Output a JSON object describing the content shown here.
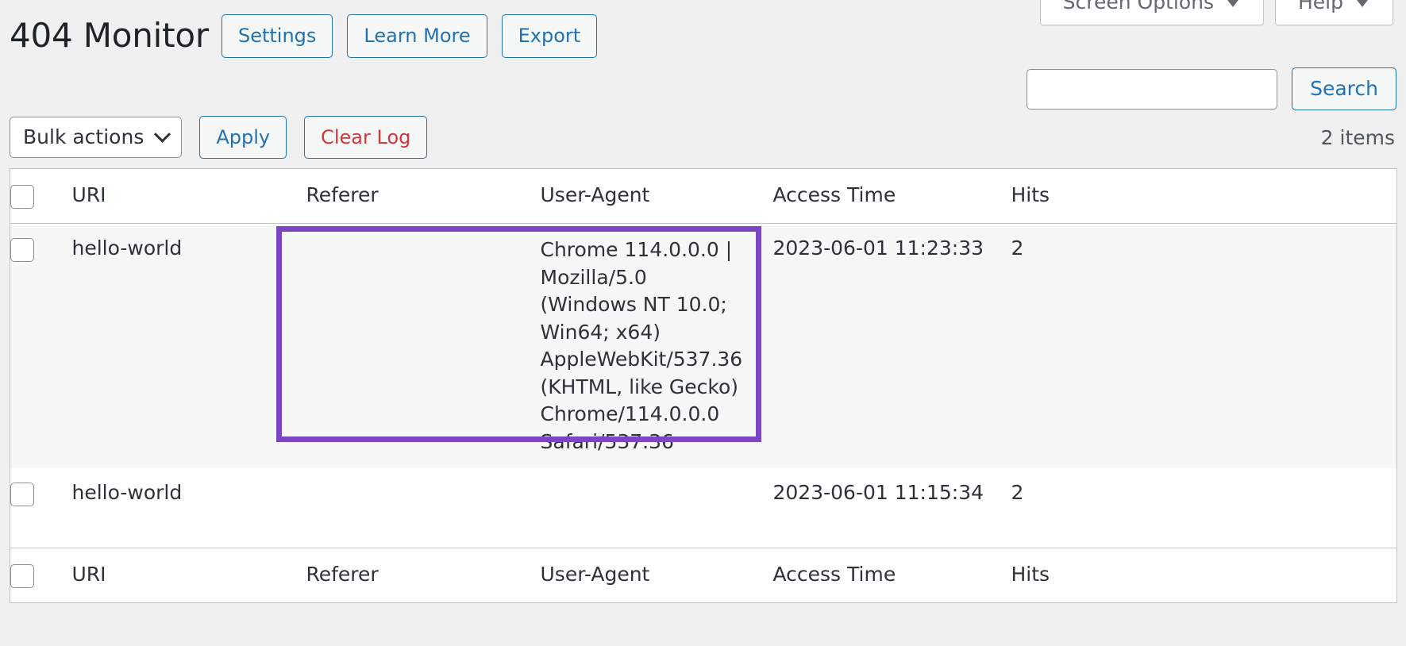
{
  "screen_meta": {
    "screen_options_label": "Screen Options",
    "help_label": "Help",
    "caret_icon": "caret-down-icon"
  },
  "header": {
    "page_title": "404 Monitor",
    "buttons": [
      {
        "label": "Settings",
        "style": "link-blue"
      },
      {
        "label": "Learn More",
        "style": "link-blue"
      },
      {
        "label": "Export",
        "style": "link-blue"
      }
    ]
  },
  "search": {
    "value": "",
    "placeholder": "",
    "button_label": "Search"
  },
  "tablenav": {
    "bulk_actions_label": "Bulk actions",
    "bulk_actions_icon": "chevron-down-icon",
    "apply_label": "Apply",
    "clear_log_label": "Clear Log",
    "items_count": "2 items"
  },
  "table": {
    "columns": [
      {
        "key": "cb",
        "label": "",
        "sortable": false
      },
      {
        "key": "uri",
        "label": "URI",
        "sortable": true
      },
      {
        "key": "ref",
        "label": "Referer",
        "sortable": false
      },
      {
        "key": "ua",
        "label": "User-Agent",
        "sortable": false
      },
      {
        "key": "time",
        "label": "Access Time",
        "sortable": true
      },
      {
        "key": "hits",
        "label": "Hits",
        "sortable": false
      }
    ],
    "rows": [
      {
        "uri": "hello-world",
        "referer": "",
        "user_agent": "Chrome 114.0.0.0 | Mozilla/5.0 (Windows NT 10.0; Win64; x64) AppleWebKit/537.36 (KHTML, like Gecko) Chrome/114.0.0.0 Safari/537.36",
        "access_time": "2023-06-01 11:23:33",
        "hits": "2"
      },
      {
        "uri": "hello-world",
        "referer": "",
        "user_agent": "",
        "access_time": "2023-06-01 11:15:34",
        "hits": "2"
      }
    ]
  },
  "annotation": {
    "name": "user-agent-column-highlight",
    "color": "#7b46c4"
  },
  "colors": {
    "link": "#2271b1",
    "danger": "#d63638",
    "page_bg": "#f0f0f1",
    "row_alt_bg": "#f6f7f7",
    "border": "#c3c4c7",
    "highlight": "#7b46c4"
  }
}
